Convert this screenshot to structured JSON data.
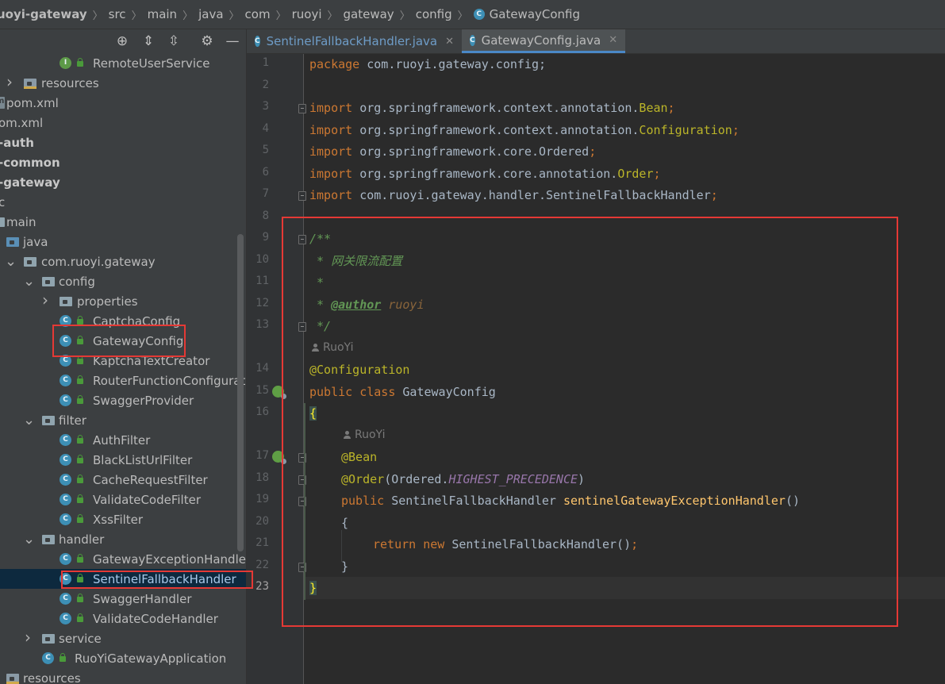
{
  "breadcrumb": {
    "items": [
      "uoyi-gateway",
      "src",
      "main",
      "java",
      "com",
      "ruoyi",
      "gateway",
      "config",
      "GatewayConfig"
    ]
  },
  "toolbar": {
    "icons": [
      "crosshair-icon",
      "expand-all-icon",
      "collapse-all-icon",
      "gear-icon",
      "minimize-icon"
    ],
    "glyphs": {
      "locate": "⊕",
      "expand": "⇕",
      "collapse": "⇳",
      "gear": "⚙",
      "hide": "—"
    }
  },
  "tree": {
    "items": [
      {
        "label": "RemoteUserService",
        "kind": "interface"
      },
      {
        "label": "resources",
        "kind": "resources-folder"
      },
      {
        "label": "pom.xml",
        "kind": "pom"
      },
      {
        "label": "om.xml",
        "kind": "pom"
      },
      {
        "label": "-auth",
        "kind": "module"
      },
      {
        "label": "-common",
        "kind": "module"
      },
      {
        "label": "-gateway",
        "kind": "module"
      },
      {
        "label": "c",
        "kind": "folder"
      },
      {
        "label": "main",
        "kind": "folder"
      },
      {
        "label": "java",
        "kind": "source-folder"
      },
      {
        "label": "com.ruoyi.gateway",
        "kind": "package"
      },
      {
        "label": "config",
        "kind": "package"
      },
      {
        "label": "properties",
        "kind": "package"
      },
      {
        "label": "CaptchaConfig",
        "kind": "class"
      },
      {
        "label": "GatewayConfig",
        "kind": "class"
      },
      {
        "label": "KaptchaTextCreator",
        "kind": "class"
      },
      {
        "label": "RouterFunctionConfiguration",
        "kind": "class"
      },
      {
        "label": "SwaggerProvider",
        "kind": "class"
      },
      {
        "label": "filter",
        "kind": "package"
      },
      {
        "label": "AuthFilter",
        "kind": "class"
      },
      {
        "label": "BlackListUrlFilter",
        "kind": "class"
      },
      {
        "label": "CacheRequestFilter",
        "kind": "class"
      },
      {
        "label": "ValidateCodeFilter",
        "kind": "class"
      },
      {
        "label": "XssFilter",
        "kind": "class"
      },
      {
        "label": "handler",
        "kind": "package"
      },
      {
        "label": "GatewayExceptionHandler",
        "kind": "class"
      },
      {
        "label": "SentinelFallbackHandler",
        "kind": "class",
        "selected": true
      },
      {
        "label": "SwaggerHandler",
        "kind": "class"
      },
      {
        "label": "ValidateCodeHandler",
        "kind": "class"
      },
      {
        "label": "service",
        "kind": "package"
      },
      {
        "label": "RuoYiGatewayApplication",
        "kind": "application"
      },
      {
        "label": "resources",
        "kind": "resources-folder"
      }
    ]
  },
  "tabs": [
    {
      "label": "SentinelFallbackHandler.java",
      "active": false,
      "close": "✕"
    },
    {
      "label": "GatewayConfig.java",
      "active": true,
      "close": "✕"
    }
  ],
  "editor": {
    "line_numbers": [
      "1",
      "2",
      "3",
      "4",
      "5",
      "6",
      "7",
      "8",
      "9",
      "10",
      "11",
      "12",
      "13",
      "14",
      "15",
      "16",
      "17",
      "18",
      "19",
      "20",
      "21",
      "22",
      "23"
    ],
    "current_line": "23",
    "author_hints": [
      "RuoYi",
      "RuoYi"
    ],
    "code": {
      "l1_kw": "package ",
      "l1_rest": "com.ruoyi.gateway.config;",
      "l3_kw": "import ",
      "l3_pkg": "org.springframework.context.annotation.",
      "l3_cls": "Bean",
      "l3_end": ";",
      "l4_kw": "import ",
      "l4_pkg": "org.springframework.context.annotation.",
      "l4_cls": "Configuration",
      "l4_end": ";",
      "l5_kw": "import ",
      "l5_rest": "org.springframework.core.Ordered",
      "l5_end": ";",
      "l6_kw": "import ",
      "l6_pkg": "org.springframework.core.annotation.",
      "l6_cls": "Order",
      "l6_end": ";",
      "l7_kw": "import ",
      "l7_rest": "com.ruoyi.gateway.handler.SentinelFallbackHandler",
      "l7_end": ";",
      "l9": "/**",
      "l10": " * 网关限流配置",
      "l11": " *",
      "l12_pre": " * ",
      "l12_tag": "@author",
      "l12_val": " ruoyi",
      "l13": " */",
      "l14": "@Configuration",
      "l15_kw": "public class ",
      "l15_rest": "GatewayConfig",
      "l16": "{",
      "l17": "@Bean",
      "l18_ann": "@Order",
      "l18_open": "(Ordered.",
      "l18_const": "HIGHEST_PRECEDENCE",
      "l18_close": ")",
      "l19_kw": "public ",
      "l19_type": "SentinelFallbackHandler ",
      "l19_fn": "sentinelGatewayExceptionHandler",
      "l19_end": "()",
      "l20": "{",
      "l21_kw": "return new ",
      "l21_rest": "SentinelFallbackHandler()",
      "l21_end": ";",
      "l22": "}",
      "l23": "}"
    }
  },
  "colors": {
    "highlight_box": "#e53935",
    "keyword": "#cc7832",
    "annotation": "#bbb529",
    "doc_comment": "#629755",
    "function": "#ffc66d"
  }
}
